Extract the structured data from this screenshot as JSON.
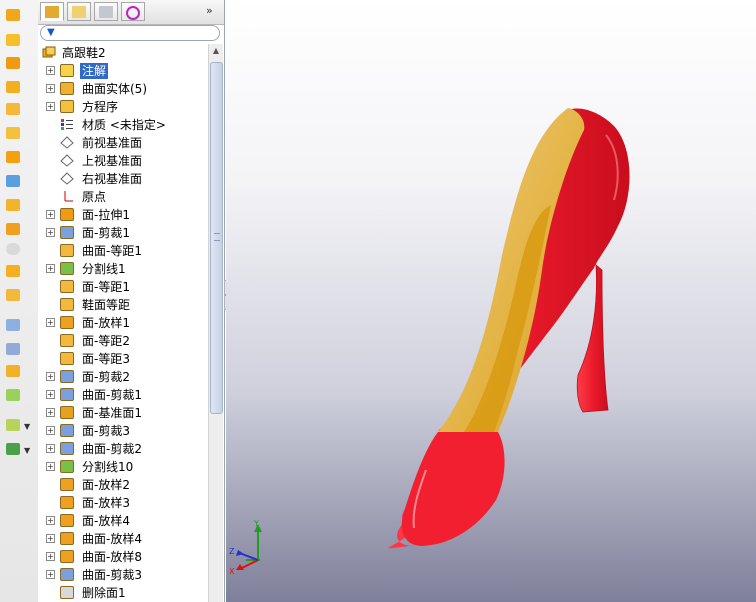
{
  "tree": {
    "root": "高跟鞋2",
    "items": [
      {
        "label": "注解",
        "expand": "+",
        "icon": "annotations-icon",
        "selected": true
      },
      {
        "label": "曲面实体(5)",
        "expand": "+",
        "icon": "surface-bodies-icon"
      },
      {
        "label": "方程序",
        "expand": "+",
        "icon": "equations-icon"
      },
      {
        "label": "材质 <未指定>",
        "expand": "",
        "icon": "material-icon"
      },
      {
        "label": "前视基准面",
        "expand": "",
        "icon": "plane-icon"
      },
      {
        "label": "上视基准面",
        "expand": "",
        "icon": "plane-icon"
      },
      {
        "label": "右视基准面",
        "expand": "",
        "icon": "plane-icon"
      },
      {
        "label": "原点",
        "expand": "",
        "icon": "origin-icon"
      },
      {
        "label": "面-拉伸1",
        "expand": "+",
        "icon": "extrude-surface-icon"
      },
      {
        "label": "面-剪裁1",
        "expand": "+",
        "icon": "trim-surface-icon"
      },
      {
        "label": "曲面-等距1",
        "expand": "",
        "icon": "offset-surface-icon"
      },
      {
        "label": "分割线1",
        "expand": "+",
        "icon": "split-line-icon"
      },
      {
        "label": "面-等距1",
        "expand": "",
        "icon": "offset-surface-icon"
      },
      {
        "label": "鞋面等距",
        "expand": "",
        "icon": "offset-surface-icon"
      },
      {
        "label": "面-放样1",
        "expand": "+",
        "icon": "loft-surface-icon"
      },
      {
        "label": "面-等距2",
        "expand": "",
        "icon": "offset-surface-icon"
      },
      {
        "label": "面-等距3",
        "expand": "",
        "icon": "offset-surface-icon"
      },
      {
        "label": "面-剪裁2",
        "expand": "+",
        "icon": "trim-surface-icon"
      },
      {
        "label": "曲面-剪裁1",
        "expand": "+",
        "icon": "trim-surface-icon"
      },
      {
        "label": "面-基准面1",
        "expand": "+",
        "icon": "planar-surface-icon"
      },
      {
        "label": "面-剪裁3",
        "expand": "+",
        "icon": "trim-surface-icon"
      },
      {
        "label": "曲面-剪裁2",
        "expand": "+",
        "icon": "trim-surface-icon"
      },
      {
        "label": "分割线10",
        "expand": "+",
        "icon": "split-line-icon"
      },
      {
        "label": "面-放样2",
        "expand": "",
        "icon": "loft-surface-icon"
      },
      {
        "label": "面-放样3",
        "expand": "",
        "icon": "loft-surface-icon"
      },
      {
        "label": "面-放样4",
        "expand": "+",
        "icon": "loft-surface-icon"
      },
      {
        "label": "曲面-放样4",
        "expand": "+",
        "icon": "loft-surface-icon"
      },
      {
        "label": "曲面-放样8",
        "expand": "+",
        "icon": "loft-surface-icon"
      },
      {
        "label": "曲面-剪裁3",
        "expand": "+",
        "icon": "trim-surface-icon"
      },
      {
        "label": "删除面1",
        "expand": "",
        "icon": "delete-face-icon"
      }
    ]
  },
  "triad": {
    "x": "X",
    "y": "Y",
    "z": "Z"
  },
  "colors": {
    "shoe": "#e8192a",
    "lining": "#e0a52a",
    "selection": "#3169c6"
  }
}
